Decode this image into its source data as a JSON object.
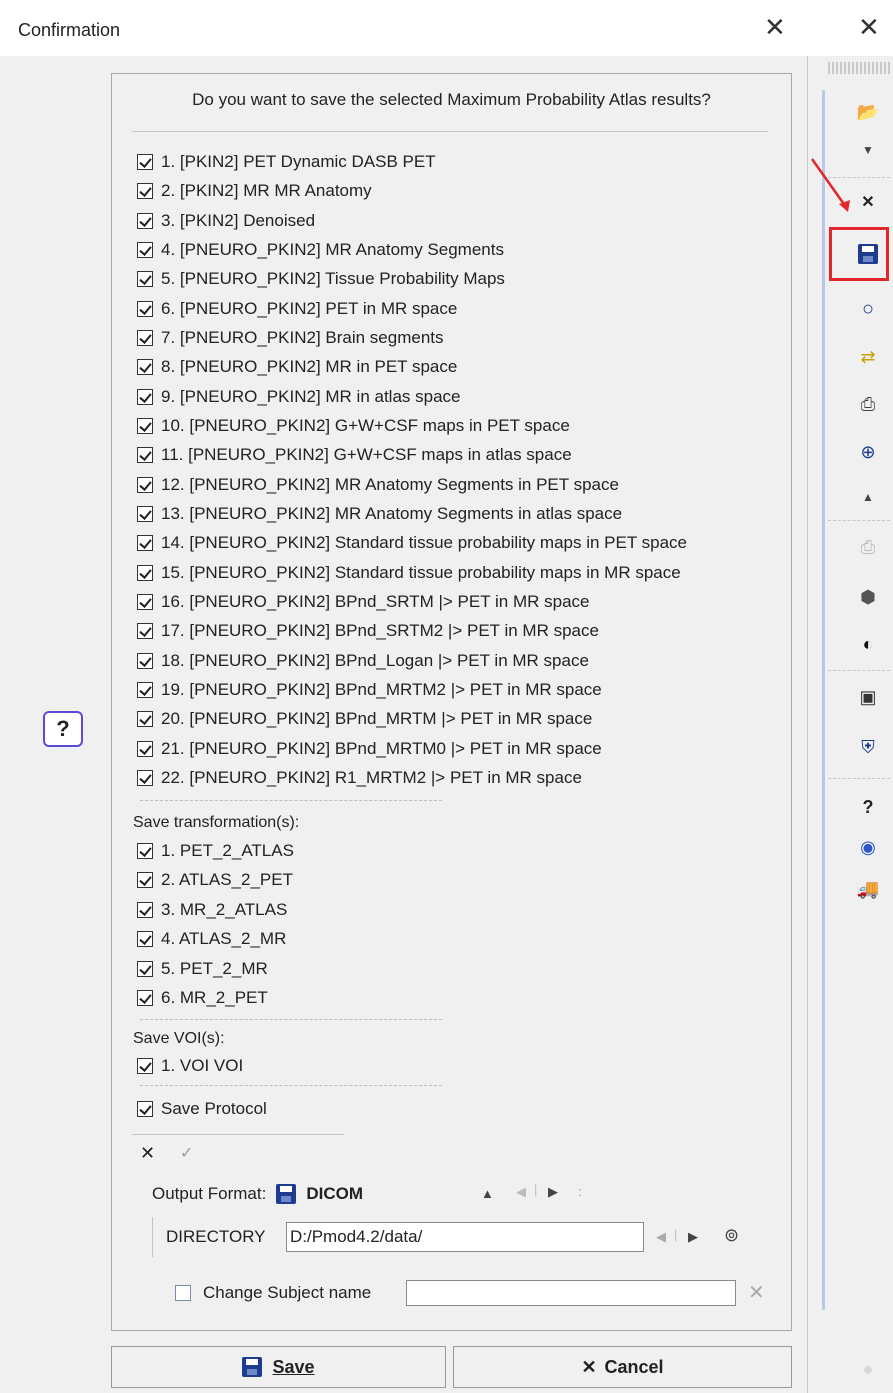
{
  "window": {
    "title": "Confirmation",
    "close_glyph": "✕"
  },
  "help_button": "?",
  "question": "Do you want to save the selected Maximum Probability Atlas results?",
  "results": [
    {
      "label": "1. [PKIN2] PET Dynamic DASB PET",
      "checked": true
    },
    {
      "label": "2. [PKIN2] MR MR Anatomy",
      "checked": true
    },
    {
      "label": "3. [PKIN2] Denoised",
      "checked": true
    },
    {
      "label": "4. [PNEURO_PKIN2] MR Anatomy Segments",
      "checked": true
    },
    {
      "label": "5. [PNEURO_PKIN2] Tissue Probability Maps",
      "checked": true
    },
    {
      "label": "6. [PNEURO_PKIN2] PET in MR space",
      "checked": true
    },
    {
      "label": "7. [PNEURO_PKIN2] Brain segments",
      "checked": true
    },
    {
      "label": "8. [PNEURO_PKIN2] MR in PET space",
      "checked": true
    },
    {
      "label": "9. [PNEURO_PKIN2] MR in atlas space",
      "checked": true
    },
    {
      "label": "10. [PNEURO_PKIN2] G+W+CSF maps in PET space",
      "checked": true
    },
    {
      "label": "11. [PNEURO_PKIN2] G+W+CSF maps in atlas space",
      "checked": true
    },
    {
      "label": "12. [PNEURO_PKIN2] MR Anatomy Segments in PET space",
      "checked": true
    },
    {
      "label": "13. [PNEURO_PKIN2] MR Anatomy Segments in atlas space",
      "checked": true
    },
    {
      "label": "14. [PNEURO_PKIN2] Standard tissue probability maps in PET space",
      "checked": true
    },
    {
      "label": "15. [PNEURO_PKIN2] Standard tissue probability maps in MR space",
      "checked": true
    },
    {
      "label": "16. [PNEURO_PKIN2] BPnd_SRTM |> PET in MR space",
      "checked": true
    },
    {
      "label": "17. [PNEURO_PKIN2] BPnd_SRTM2 |> PET in MR space",
      "checked": true
    },
    {
      "label": "18. [PNEURO_PKIN2] BPnd_Logan |> PET in MR space",
      "checked": true
    },
    {
      "label": "19. [PNEURO_PKIN2] BPnd_MRTM2 |> PET in MR space",
      "checked": true
    },
    {
      "label": "20. [PNEURO_PKIN2] BPnd_MRTM |> PET in MR space",
      "checked": true
    },
    {
      "label": "21. [PNEURO_PKIN2] BPnd_MRTM0 |> PET in MR space",
      "checked": true
    },
    {
      "label": "22. [PNEURO_PKIN2] R1_MRTM2 |> PET in MR space",
      "checked": true
    }
  ],
  "transformations": {
    "heading": "Save transformation(s):",
    "items": [
      {
        "label": "1. PET_2_ATLAS",
        "checked": true
      },
      {
        "label": "2. ATLAS_2_PET",
        "checked": true
      },
      {
        "label": "3. MR_2_ATLAS",
        "checked": true
      },
      {
        "label": "4. ATLAS_2_MR",
        "checked": true
      },
      {
        "label": "5. PET_2_MR",
        "checked": true
      },
      {
        "label": "6. MR_2_PET",
        "checked": true
      }
    ]
  },
  "vois": {
    "heading": "Save VOI(s):",
    "items": [
      {
        "label": "1. VOI VOI",
        "checked": true
      }
    ]
  },
  "save_protocol": {
    "label": "Save Protocol",
    "checked": true
  },
  "select_none_glyph": "✕",
  "select_all_glyph": "✓",
  "output": {
    "label": "Output Format:",
    "format": "DICOM",
    "directory_label": "DIRECTORY",
    "directory_value": "D:/Pmod4.2/data/"
  },
  "change_subject": {
    "label": "Change Subject name",
    "checked": false,
    "value": ""
  },
  "buttons": {
    "save_label": "Save",
    "cancel_label": "Cancel",
    "cancel_glyph": "✕"
  },
  "toolbar_close_glyph": "✕",
  "toolbar_help_glyph": "?",
  "accent_colors": {
    "highlight": "#e3262b",
    "help_border": "#5a4bd6",
    "floppy": "#1d3b8f"
  }
}
